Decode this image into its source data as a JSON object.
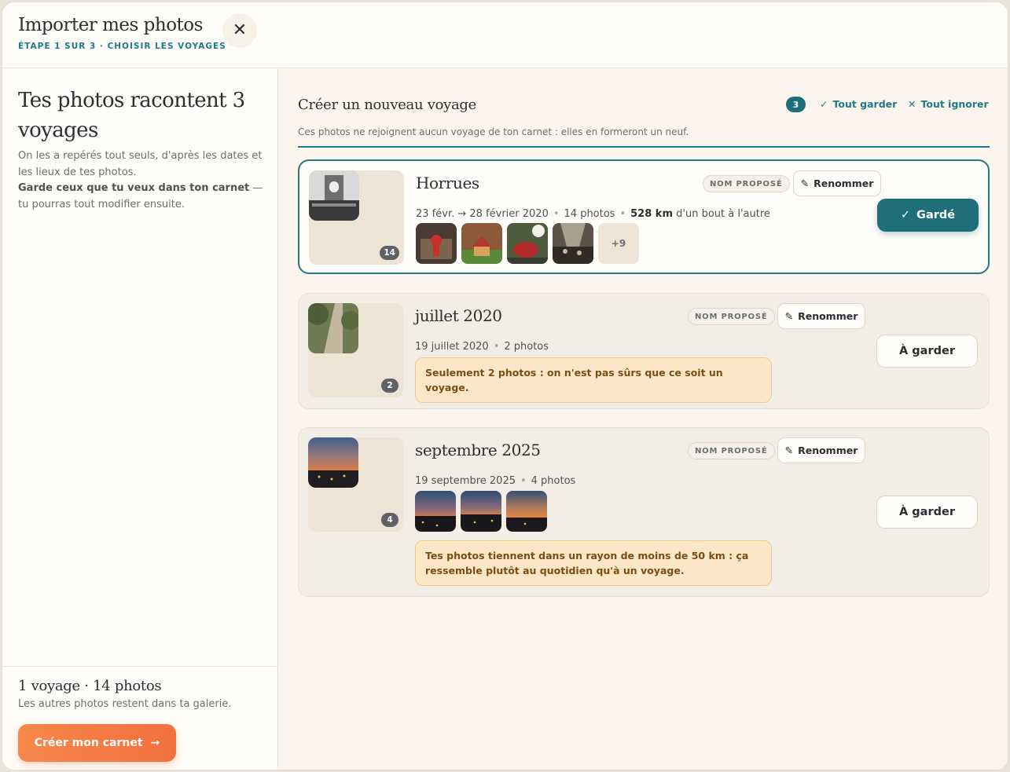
{
  "header": {
    "title": "Importer mes photos",
    "step": "ÉTAPE 1 SUR 3 · CHOISIR LES VOYAGES",
    "close_icon": "close-icon"
  },
  "sidebar": {
    "title": "Tes photos racontent 3 voyages",
    "text_1": "On les a repérés tout seuls, d'après les dates et les lieux de tes photos.",
    "text_2_bold": "Garde ceux que tu veux dans ton carnet",
    "text_2_rest": " — tu pourras tout modifier ensuite."
  },
  "footer": {
    "summary": "1 voyage · 14 photos",
    "note": "Les autres photos restent dans ta galerie.",
    "cta_label": "Créer mon carnet",
    "cta_icon": "arrow-right-icon"
  },
  "section": {
    "title": "Créer un nouveau voyage",
    "description": "Ces photos ne rejoignent aucun voyage de ton carnet : elles en formeront un neuf.",
    "count": "3",
    "keep_all": "Tout garder",
    "ignore_all": "Tout ignorer"
  },
  "trips": [
    {
      "name": "Horrues",
      "tag": "NOM PROPOSÉ",
      "rename": "Renommer",
      "dates": "23 févr. → 28 février 2020",
      "photos": "14 photos",
      "distance_value": "528 km",
      "distance_rest": "d'un bout à l'autre",
      "cover_count": "14",
      "more": "+9",
      "keep_label": "Gardé",
      "kept": true
    },
    {
      "name": "juillet 2020",
      "tag": "NOM PROPOSÉ",
      "rename": "Renommer",
      "dates": "19 juillet 2020",
      "photos": "2 photos",
      "cover_count": "2",
      "warning": "Seulement 2 photos : on n'est pas sûrs que ce soit un voyage.",
      "keep_label": "À garder",
      "kept": false
    },
    {
      "name": "septembre 2025",
      "tag": "NOM PROPOSÉ",
      "rename": "Renommer",
      "dates": "19 septembre 2025",
      "photos": "4 photos",
      "cover_count": "4",
      "warning": "Tes photos tiennent dans un rayon de moins de 50 km : ça ressemble plutôt au quotidien qu'à un voyage.",
      "keep_label": "À garder",
      "kept": false
    }
  ],
  "colors": {
    "accent": "#1e7b86",
    "cta": "#f2703f",
    "warning_bg": "#fbe7c8"
  }
}
